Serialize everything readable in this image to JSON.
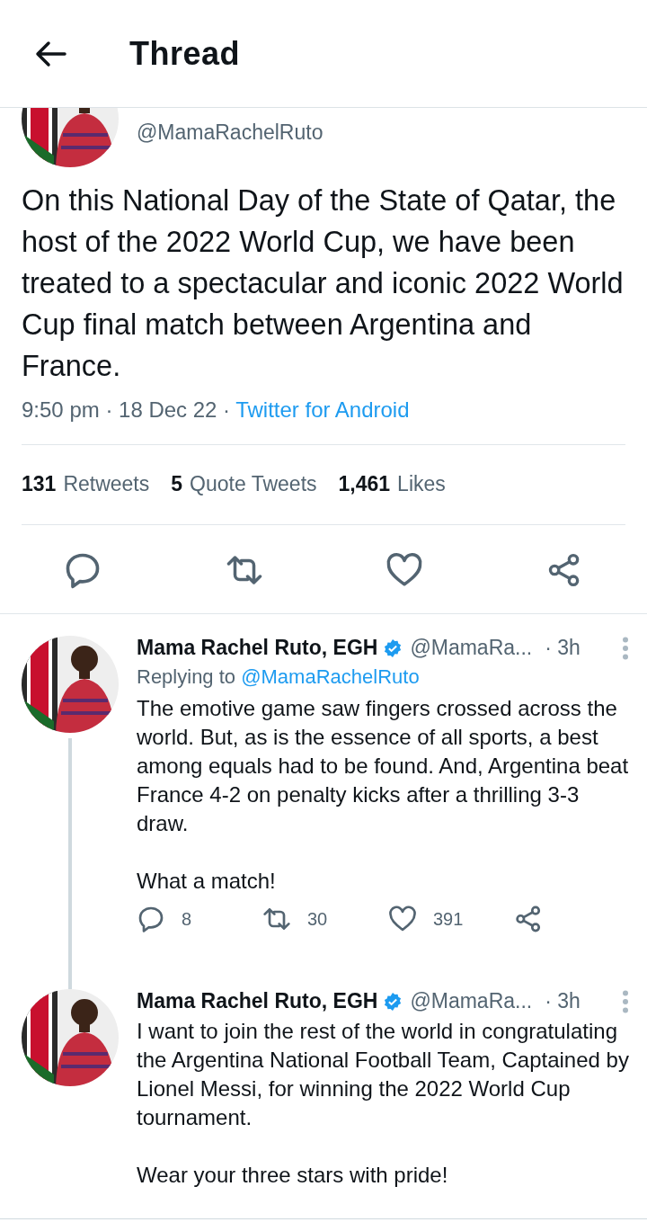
{
  "header": {
    "title": "Thread"
  },
  "main_tweet": {
    "handle": "@MamaRachelRuto",
    "text": "On this National Day of the State of Qatar, the host of the 2022 World Cup, we have been treated to a spectacular and iconic 2022 World Cup final match between Argentina and France.",
    "timestamp": "9:50 pm · 18 Dec 22 ·",
    "source": "Twitter for Android",
    "stats": [
      {
        "count": "131",
        "label": "Retweets"
      },
      {
        "count": "5",
        "label": "Quote Tweets"
      },
      {
        "count": "1,461",
        "label": "Likes"
      }
    ]
  },
  "replies": [
    {
      "name": "Mama Rachel Ruto, EGH",
      "verified": true,
      "handle": "@MamaRa...",
      "age": "· 3h",
      "replying_to_label": "Replying to",
      "replying_to": "@MamaRachelRuto",
      "paragraphs": [
        "The emotive game saw fingers crossed across the world. But, as is the essence of all sports, a best among equals had to be found. And, Argentina beat France 4-2 on penalty kicks after a thrilling 3-3 draw.",
        "What a match!"
      ],
      "counts": {
        "replies": "8",
        "retweets": "30",
        "likes": "391"
      },
      "connected": true
    },
    {
      "name": "Mama Rachel Ruto, EGH",
      "verified": true,
      "handle": "@MamaRa...",
      "age": "· 3h",
      "paragraphs": [
        "I want to join the rest of the world in congratulating the Argentina National Football Team, Captained by Lionel Messi, for winning the 2022 World Cup tournament.",
        "Wear your three stars with pride!"
      ],
      "connected": false
    }
  ]
}
